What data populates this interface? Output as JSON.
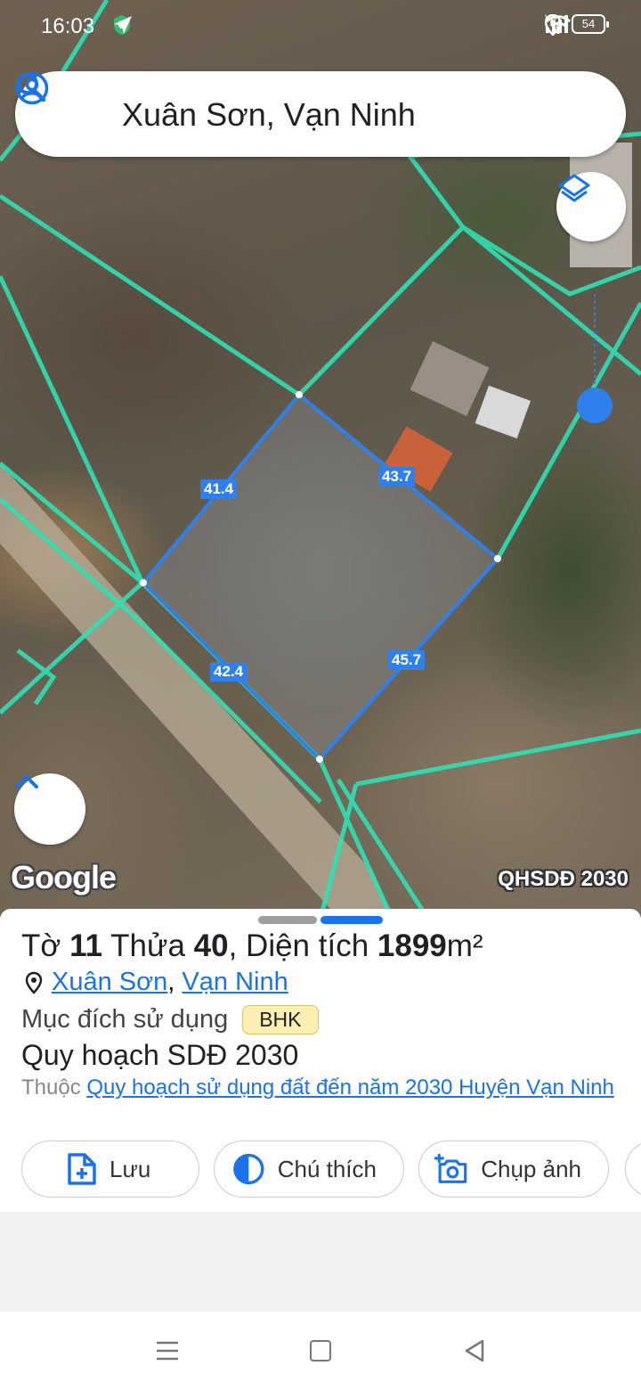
{
  "status_bar": {
    "time": "16:03",
    "volte_label": "Vo\nLTE",
    "battery": "54"
  },
  "search": {
    "query": "Xuân Sơn, Vạn Ninh"
  },
  "map": {
    "attribution": "Google",
    "layer_label": "QHSDĐ 2030",
    "dimensions": [
      "41.4",
      "43.7",
      "42.4",
      "45.7"
    ]
  },
  "parcel": {
    "sheet_label": "Tờ",
    "sheet_no": "11",
    "plot_label": "Thửa",
    "plot_no": "40",
    "area_label": ", Diện tích",
    "area_value": "1899",
    "area_unit": "m²",
    "commune": "Xuân Sơn",
    "separator": ",",
    "district": "Vạn Ninh",
    "purpose_label": "Mục đích sử dụng",
    "purpose_code": "BHK",
    "plan_title": "Quy hoạch SDĐ 2030",
    "belongs_label": "Thuộc",
    "plan_link": "Quy hoạch sử dụng đất đến năm 2030 Huyện Vạn Ninh"
  },
  "actions": [
    {
      "label": "Lưu",
      "icon": "file-add-icon"
    },
    {
      "label": "Chú thích",
      "icon": "contrast-icon"
    },
    {
      "label": "Chụp ảnh",
      "icon": "camera-add-icon"
    }
  ],
  "colors": {
    "parcel_border": "#2f80ed",
    "cadastral_lines": "#2fe0b3",
    "link": "#1a73e8",
    "badge_bg": "#fcefb4"
  }
}
